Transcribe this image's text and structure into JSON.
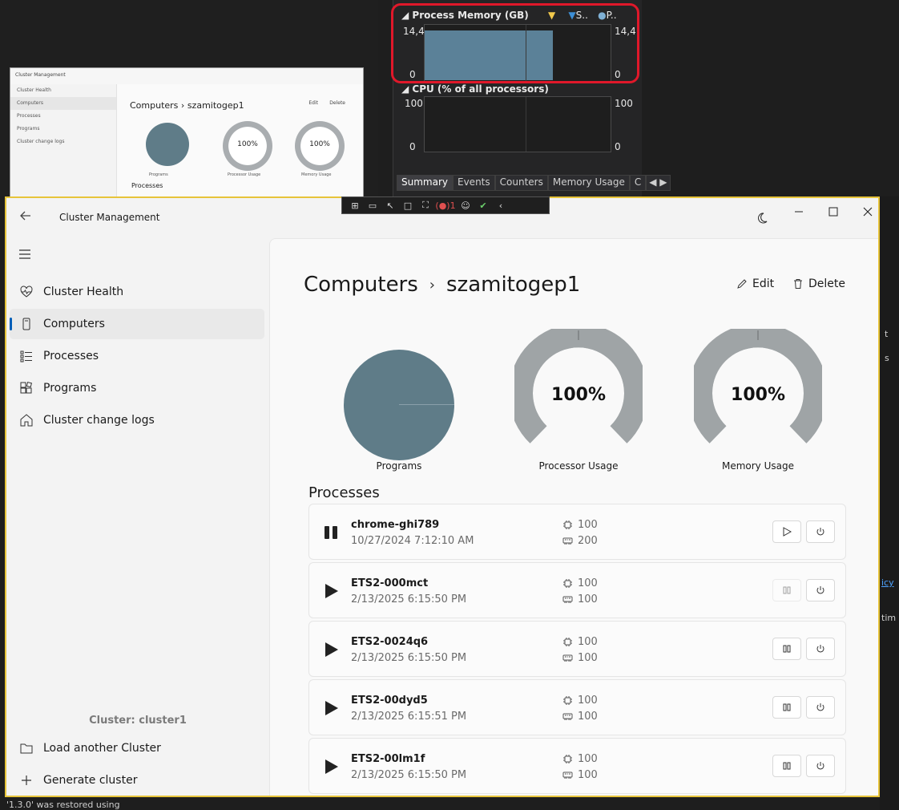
{
  "ide_panel": {
    "memory_title": "Process Memory (GB)",
    "memory_legend_s": "S..",
    "memory_legend_p": "P..",
    "memory_max": "14,4",
    "memory_min": "0",
    "cpu_title": "CPU (% of all processors)",
    "cpu_max": "100",
    "cpu_min": "0",
    "tabs": [
      "Summary",
      "Events",
      "Counters",
      "Memory Usage",
      "C"
    ]
  },
  "bg_fragments": {
    "restored": "'1.3.0' was restored using",
    "right_top": "t",
    "right_s": "s",
    "right_cy": "icy",
    "right_im": "tim"
  },
  "thumbnail": {
    "app_title": "Cluster Management",
    "nav": [
      "Cluster Health",
      "Computers",
      "Processes",
      "Programs",
      "Cluster change logs"
    ],
    "heading_section": "Computers",
    "heading_item": "szamitogep1",
    "edit": "Edit",
    "delete": "Delete",
    "gauge1": "100%",
    "gauge2": "100%",
    "caption1": "Programs",
    "caption2": "Processor Usage",
    "caption3": "Memory Usage",
    "processes": "Processes"
  },
  "app": {
    "title": "Cluster Management",
    "nav": [
      {
        "label": "Cluster Health"
      },
      {
        "label": "Computers"
      },
      {
        "label": "Processes"
      },
      {
        "label": "Programs"
      },
      {
        "label": "Cluster change logs"
      }
    ],
    "cluster_label": "Cluster: cluster1",
    "footer_nav": [
      {
        "label": "Load another Cluster"
      },
      {
        "label": "Generate cluster"
      }
    ]
  },
  "page": {
    "breadcrumb_section": "Computers",
    "breadcrumb_item": "szamitogep1",
    "edit_label": "Edit",
    "delete_label": "Delete",
    "charts": {
      "programs_caption": "Programs",
      "processor_caption": "Processor Usage",
      "processor_value": "100%",
      "processor_fraction": 1.0,
      "memory_caption": "Memory Usage",
      "memory_value": "100%",
      "memory_fraction": 1.0
    },
    "processes_title": "Processes",
    "processes": [
      {
        "name": "chrome-ghi789",
        "date": "10/27/2024 7:12:10 AM",
        "cpu": "100",
        "mem": "200",
        "state": "running"
      },
      {
        "name": "ETS2-000mct",
        "date": "2/13/2025 6:15:50 PM",
        "cpu": "100",
        "mem": "100",
        "state": "paused"
      },
      {
        "name": "ETS2-0024q6",
        "date": "2/13/2025 6:15:50 PM",
        "cpu": "100",
        "mem": "100",
        "state": "paused"
      },
      {
        "name": "ETS2-00dyd5",
        "date": "2/13/2025 6:15:51 PM",
        "cpu": "100",
        "mem": "100",
        "state": "paused"
      },
      {
        "name": "ETS2-00lm1f",
        "date": "2/13/2025 6:15:50 PM",
        "cpu": "100",
        "mem": "100",
        "state": "paused"
      }
    ]
  }
}
